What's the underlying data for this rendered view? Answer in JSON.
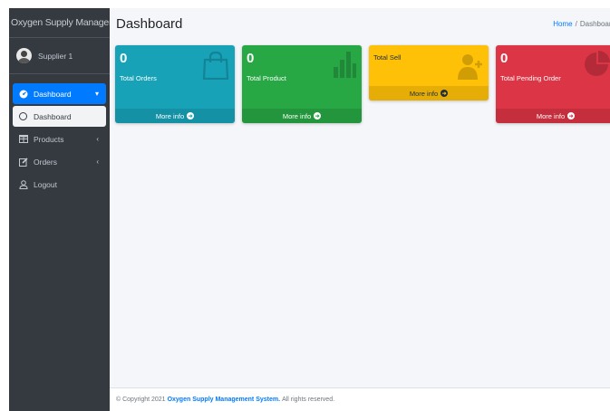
{
  "app": {
    "brand": "Oxygen Supply Management",
    "user_name": "Supplier 1"
  },
  "sidebar": {
    "items": [
      {
        "label": "Dashboard",
        "icon": "tachometer-icon",
        "state": "active",
        "caret": "▾"
      },
      {
        "label": "Dashboard",
        "icon": "circle-icon",
        "state": "sub-active"
      },
      {
        "label": "Products",
        "icon": "table-icon",
        "caret": "‹"
      },
      {
        "label": "Orders",
        "icon": "edit-icon",
        "caret": "‹"
      },
      {
        "label": "Logout",
        "icon": "user-icon"
      }
    ]
  },
  "header": {
    "title": "Dashboard",
    "breadcrumb": {
      "home": "Home",
      "separator": "/",
      "current": "Dashboard"
    }
  },
  "boxes": [
    {
      "count": "0",
      "label": "Total Orders",
      "more": "More info",
      "color": "#17a2b8",
      "icon": "shopping-bag-icon"
    },
    {
      "count": "0",
      "label": "Total Product",
      "more": "More info",
      "color": "#28a745",
      "icon": "bar-chart-icon"
    },
    {
      "count": "",
      "label": "Total Sell",
      "more": "More info",
      "color": "#ffc107",
      "icon": "user-plus-icon"
    },
    {
      "count": "0",
      "label": "Total Pending Order",
      "more": "More info",
      "color": "#dc3545",
      "icon": "pie-chart-icon"
    }
  ],
  "footer": {
    "prefix": "© Copyright 2021",
    "system_name": "Oxygen Supply Management System.",
    "suffix": "All rights reserved."
  }
}
